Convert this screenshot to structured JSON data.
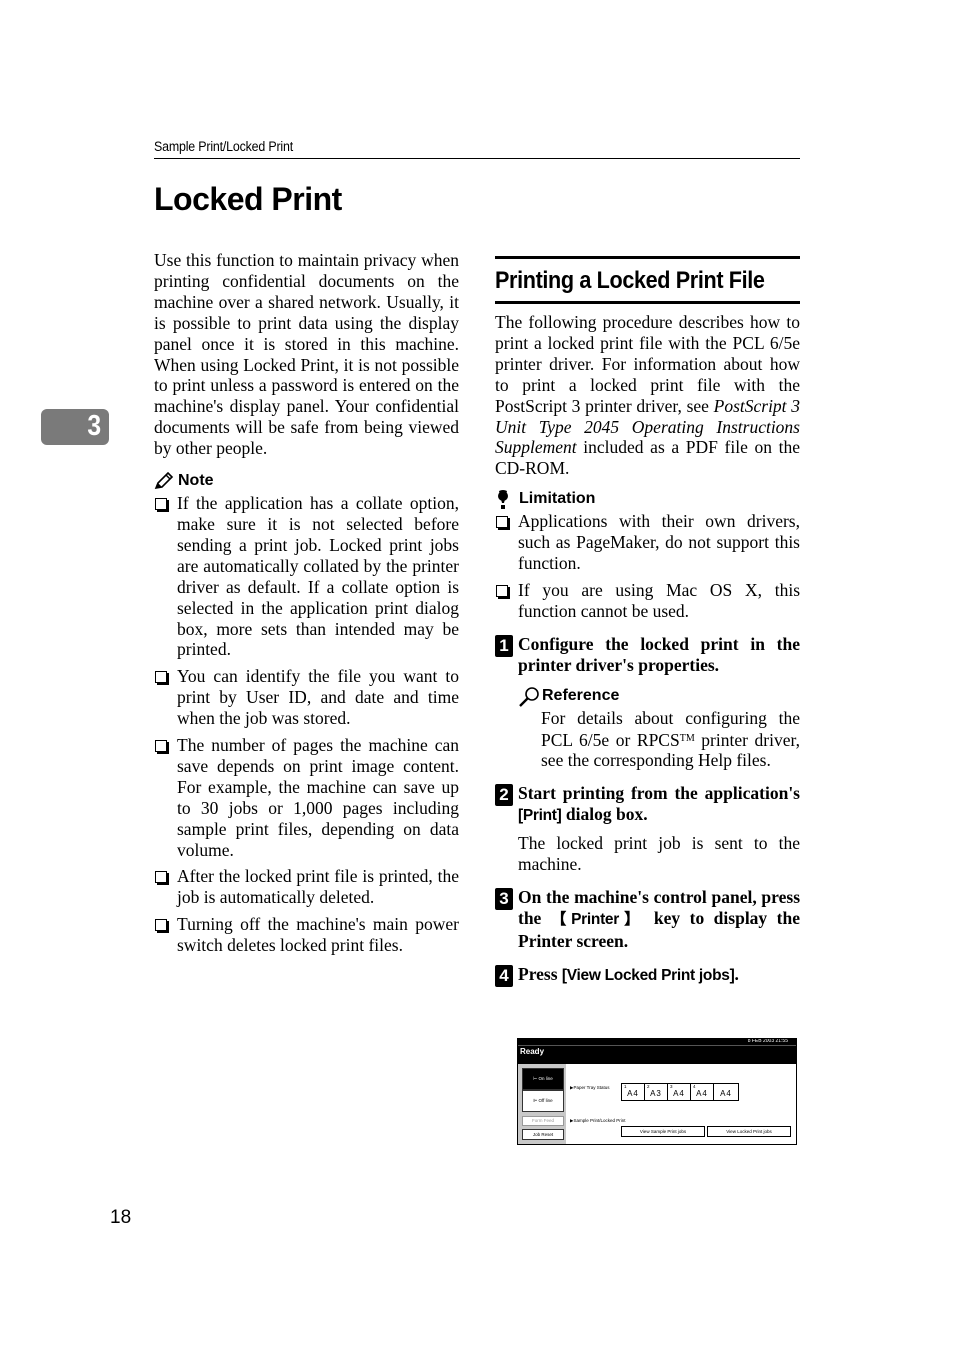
{
  "header": {
    "running_head": "Sample Print/Locked Print"
  },
  "chapter_tab": "3",
  "title": "Locked Print",
  "left_column": {
    "intro": "Use this function to maintain privacy when printing confidential documents on the machine over a shared network. Usually, it is possible to print data using the display panel once it is stored in this machine. When using Locked Print, it is not possible to print unless a password is entered on the machine's display panel. Your confidential documents will be safe from being viewed by other people.",
    "note": {
      "icon": "pencil-icon",
      "heading": "Note",
      "items": [
        "If the application has a collate option, make sure it is not selected before sending a print job. Locked print jobs are automatically collated by the printer driver as default. If a collate option is selected in the application print dialog box, more sets than intended may be printed.",
        "You can identify the file you want to print by User ID, and date and time when the job was stored.",
        "The number of pages the machine can save depends on print image content. For example, the machine can save up to 30 jobs or 1,000 pages including sample print files, depending on data volume.",
        "After the locked print file is printed, the job is automatically deleted.",
        "Turning off the machine's main power switch deletes locked print files."
      ]
    }
  },
  "right_column": {
    "section_title": "Printing a Locked Print File",
    "intro_pre": "The following procedure describes how to print a locked print file with the PCL 6/5e printer driver. For information about how to print a locked print file with the PostScript 3 printer driver, see ",
    "intro_italic": "PostScript 3 Unit Type 2045 Operating Instructions Supplement",
    "intro_post": " included as a PDF file on the CD-ROM.",
    "limitation": {
      "icon": "exclamation-icon",
      "heading": "Limitation",
      "items": [
        "Applications with their own drivers, such as PageMaker, do not support this function.",
        "If you are using Mac OS X, this function cannot be used."
      ]
    },
    "steps": [
      {
        "number": "1",
        "instruction": "Configure the locked print in the printer driver's properties.",
        "reference": {
          "icon": "magnifier-icon",
          "heading": "Reference",
          "text_pre": "For details about configuring the PCL 6/5e or RPCS",
          "text_tm": "TM",
          "text_post": " printer driver, see the corresponding Help files."
        }
      },
      {
        "number": "2",
        "instruction_pre": "Start printing from the application's ",
        "instruction_key": "[Print]",
        "instruction_post": " dialog box.",
        "description": "The locked print job is sent to the machine."
      },
      {
        "number": "3",
        "instruction_pre": "On the machine's control panel, press the ",
        "instruction_key": "【Printer】",
        "instruction_post": " key to display the Printer screen."
      },
      {
        "number": "4",
        "instruction_pre": "Press ",
        "instruction_key": "[View Locked Print jobs]",
        "instruction_post": "."
      }
    ],
    "screen": {
      "clock": "8 FEB 2003 21:55",
      "status": "Ready",
      "side_buttons": {
        "online": "⊢ On line",
        "offline": "⊫ Off line",
        "form_feed": "Form Feed",
        "job_reset": "Job Reset"
      },
      "paper_tray_label": "▶Paper Tray Status",
      "trays": [
        {
          "label": "1",
          "size": "A4"
        },
        {
          "label": "2",
          "size": "A3"
        },
        {
          "label": "3",
          "size": "A4"
        },
        {
          "label": "4",
          "size": "A4"
        },
        {
          "label": "",
          "size": "A4"
        }
      ],
      "sample_label": "▶Sample Print/Locked Print",
      "view_sample_button": "View Sample Print jobs",
      "view_locked_button": "View Locked Print jobs"
    }
  },
  "page_number": "18"
}
